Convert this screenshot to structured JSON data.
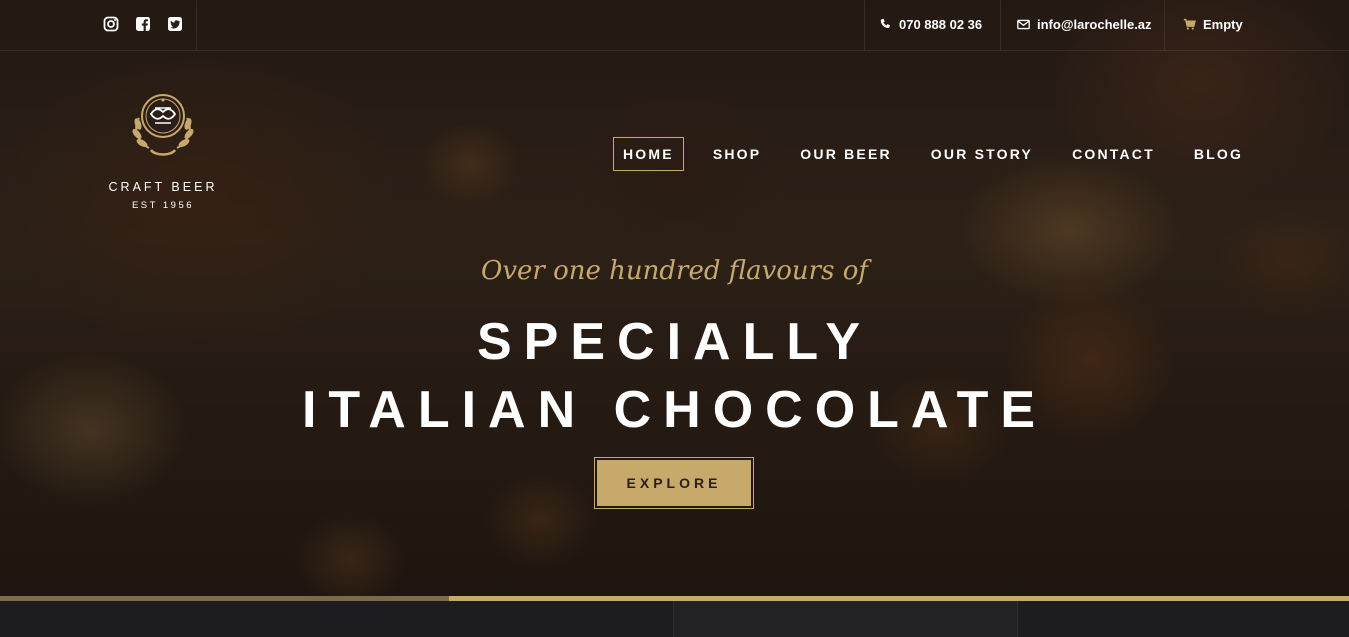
{
  "colors": {
    "accent": "#c8a96c",
    "dark": "#1e1e20"
  },
  "topbar": {
    "socials": [
      {
        "icon": "instagram-icon"
      },
      {
        "icon": "facebook-icon"
      },
      {
        "icon": "twitter-icon"
      }
    ],
    "phone": "070 888 02 36",
    "email": "info@larochelle.az",
    "cart": "Empty"
  },
  "logo": {
    "title": "CRAFT BEER",
    "subtitle": "EST 1956"
  },
  "nav": {
    "items": [
      "HOME",
      "SHOP",
      "OUR BEER",
      "OUR STORY",
      "CONTACT",
      "BLOG"
    ],
    "active": "HOME"
  },
  "hero": {
    "tagline": "Over one hundred flavours of",
    "headline_line1": "SPECIALLY",
    "headline_line2": "ITALIAN CHOCOLATE",
    "cta": "EXPLORE"
  },
  "slider": {
    "progress": 0.333
  }
}
